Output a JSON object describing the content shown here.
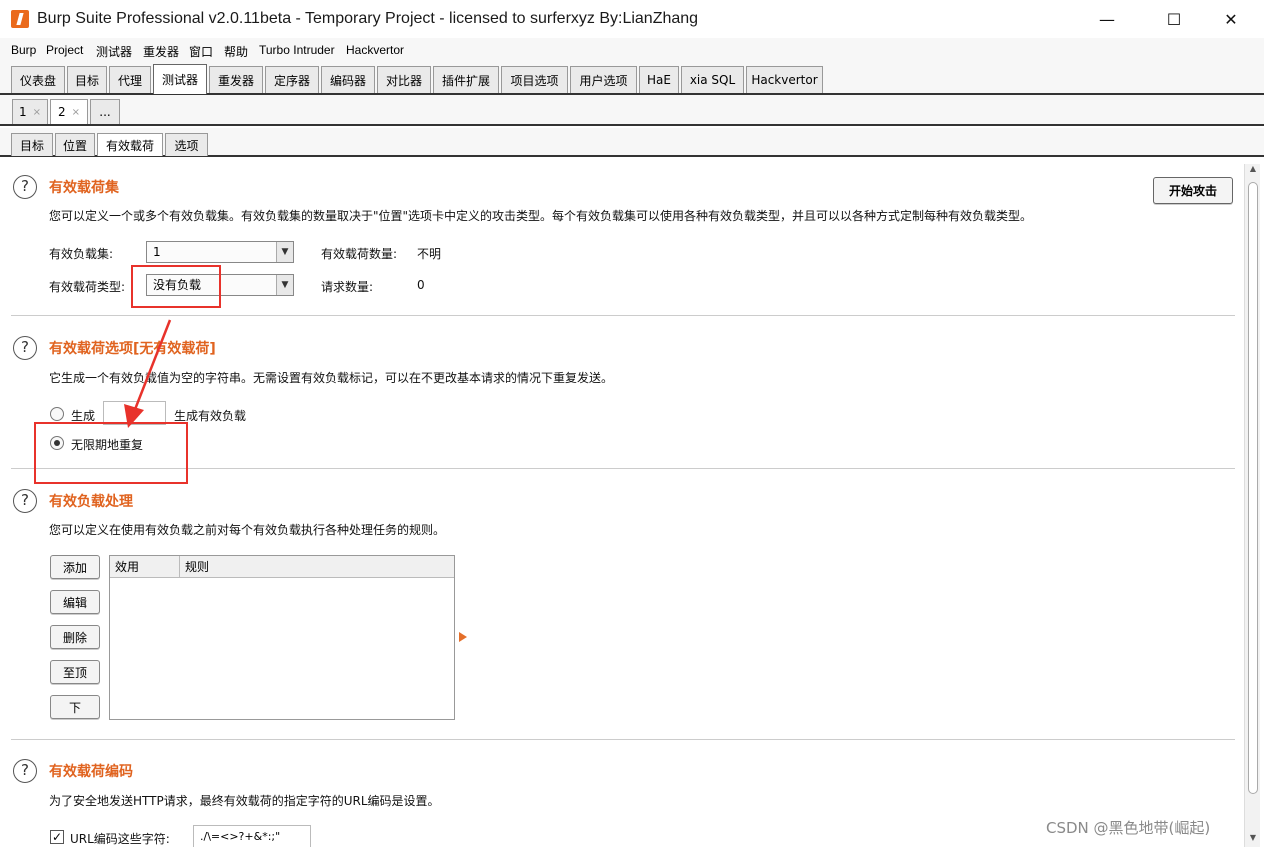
{
  "window": {
    "title": "Burp Suite Professional v2.0.11beta - Temporary Project - licensed to surferxyz By:LianZhang",
    "minimize": "—",
    "maximize": "☐",
    "close": "✕"
  },
  "menubar": [
    "Burp",
    "Project",
    "测试器",
    "重发器",
    "窗口",
    "帮助",
    "Turbo Intruder",
    "Hackvertor"
  ],
  "main_tabs": [
    "仪表盘",
    "目标",
    "代理",
    "测试器",
    "重发器",
    "定序器",
    "编码器",
    "对比器",
    "插件扩展",
    "项目选项",
    "用户选项",
    "HaE",
    "xia SQL",
    "Hackvertor"
  ],
  "main_tab_active": "测试器",
  "attack_tabs": [
    {
      "label": "1",
      "close": "×"
    },
    {
      "label": "2",
      "close": "×"
    },
    {
      "label": "..."
    }
  ],
  "sub_tabs": [
    "目标",
    "位置",
    "有效载荷",
    "选项"
  ],
  "sub_tab_active": "有效载荷",
  "payload_sets": {
    "help": "?",
    "title": "有效载荷集",
    "description": "您可以定义一个或多个有效负载集。有效负载集的数量取决于\"位置\"选项卡中定义的攻击类型。每个有效负载集可以使用各种有效负载类型，并且可以以各种方式定制每种有效负载类型。",
    "set_label": "有效负载集:",
    "set_value": "1",
    "type_label": "有效载荷类型:",
    "type_value": "没有负载",
    "count_label": "有效载荷数量:",
    "count_value": "不明",
    "request_label": "请求数量:",
    "request_value": "0",
    "start_attack": "开始攻击",
    "arrow_glyph": "▼"
  },
  "payload_options": {
    "help": "?",
    "title": "有效载荷选项[无有效载荷]",
    "description": "它生成一个有效负载值为空的字符串。无需设置有效负载标记，可以在不更改基本请求的情况下重复发送。",
    "generate_label": "生成",
    "generate_value": "",
    "generate_suffix": "生成有效负载",
    "indefinite_label": "无限期地重复",
    "selected": "indefinite"
  },
  "payload_processing": {
    "help": "?",
    "title": "有效负载处理",
    "description": "您可以定义在使用有效负载之前对每个有效负载执行各种处理任务的规则。",
    "buttons": [
      "添加",
      "编辑",
      "删除",
      "至顶",
      "下"
    ],
    "columns": [
      "效用",
      "规则"
    ]
  },
  "payload_encoding": {
    "help": "?",
    "title": "有效载荷编码",
    "description": "为了安全地发送HTTP请求，最终有效载荷的指定字符的URL编码是设置。",
    "checkbox_label": "URL编码这些字符:",
    "checkbox_checked": true,
    "checkbox_mark": "✓",
    "chars_value": "./\\=<>?+&*:;\"{}|^`"
  },
  "scrollbar": {
    "up": "▲",
    "down": "▼"
  },
  "watermark": "CSDN @黑色地带(崛起)"
}
